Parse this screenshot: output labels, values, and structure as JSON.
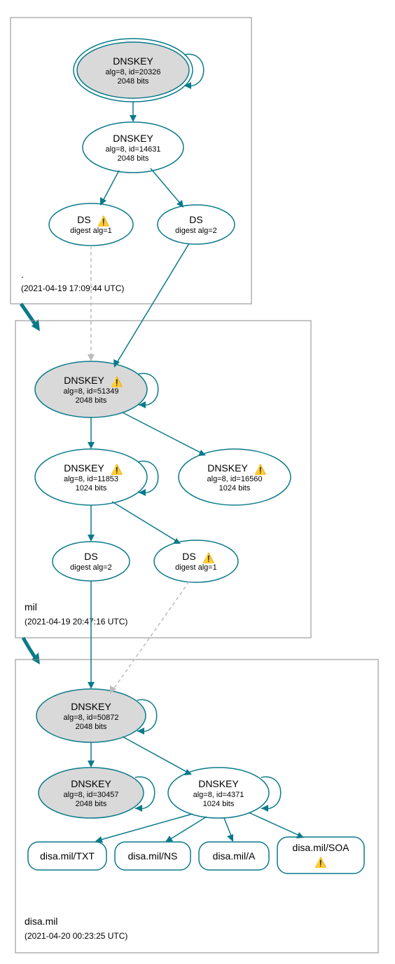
{
  "zones": {
    "root": {
      "name": ".",
      "timestamp": "(2021-04-19 17:09:44 UTC)",
      "nodes": {
        "ksk": {
          "title": "DNSKEY",
          "line2": "alg=8, id=20326",
          "line3": "2048 bits",
          "warn": false
        },
        "zsk": {
          "title": "DNSKEY",
          "line2": "alg=8, id=14631",
          "line3": "2048 bits",
          "warn": false
        },
        "ds1": {
          "title": "DS",
          "line2": "digest alg=1",
          "warn": true
        },
        "ds2": {
          "title": "DS",
          "line2": "digest alg=2",
          "warn": false
        }
      }
    },
    "mil": {
      "name": "mil",
      "timestamp": "(2021-04-19 20:47:16 UTC)",
      "nodes": {
        "ksk": {
          "title": "DNSKEY",
          "line2": "alg=8, id=51349",
          "line3": "2048 bits",
          "warn": true
        },
        "zsk1": {
          "title": "DNSKEY",
          "line2": "alg=8, id=11853",
          "line3": "1024 bits",
          "warn": true
        },
        "zsk2": {
          "title": "DNSKEY",
          "line2": "alg=8, id=16560",
          "line3": "1024 bits",
          "warn": true
        },
        "ds1": {
          "title": "DS",
          "line2": "digest alg=2",
          "warn": false
        },
        "ds2": {
          "title": "DS",
          "line2": "digest alg=1",
          "warn": true
        }
      }
    },
    "disa": {
      "name": "disa.mil",
      "timestamp": "(2021-04-20 00:23:25 UTC)",
      "nodes": {
        "ksk": {
          "title": "DNSKEY",
          "line2": "alg=8, id=50872",
          "line3": "2048 bits",
          "warn": false
        },
        "zsk1": {
          "title": "DNSKEY",
          "line2": "alg=8, id=30457",
          "line3": "2048 bits",
          "warn": false
        },
        "zsk2": {
          "title": "DNSKEY",
          "line2": "alg=8, id=4371",
          "line3": "1024 bits",
          "warn": false
        },
        "rr1": {
          "label": "disa.mil/TXT",
          "warn": false
        },
        "rr2": {
          "label": "disa.mil/NS",
          "warn": false
        },
        "rr3": {
          "label": "disa.mil/A",
          "warn": false
        },
        "rr4": {
          "label": "disa.mil/SOA",
          "warn": true
        }
      }
    }
  }
}
